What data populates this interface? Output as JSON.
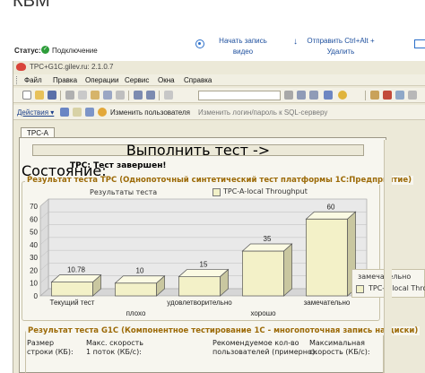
{
  "page_heading": "КВМ",
  "topbar": {
    "status_label": "Статус:",
    "status_value": "Подключение",
    "record_label_1": "Начать запись",
    "record_label_2": "видео",
    "send_label_1": "Отправить Ctrl+Alt +",
    "send_label_2": "Удалить"
  },
  "window": {
    "title": "TPC+G1C.gilev.ru: 2.1.0.7"
  },
  "menu": [
    "Файл",
    "Правка",
    "Операции",
    "Сервис",
    "Окна",
    "Справка"
  ],
  "actionbar": {
    "actions_label": "Действия ▾",
    "change_user_label": "Изменить пользователя",
    "change_login_label": "Изменить логин/пароль к SQL-серверу"
  },
  "tab_label": "TPC-A",
  "run_test_label": "Выполнить тест ->",
  "state": {
    "label": "Состояние:",
    "value": "TPC: Тест завершен!"
  },
  "group1_title": "Результат теста TPC (Однопоточный синтетический тест платформы 1С:Предприятие)",
  "legend": {
    "left": "Результаты теста",
    "right": "TPC-A-local Throughput",
    "side_line1": "замечательно",
    "side_line2": "TPC-A-local Throughput"
  },
  "colors": {
    "bar_front": "#f3f1c8",
    "bar_side": "#c9c7a0",
    "bar_top": "#fbfae3",
    "plot_back": "#e9e9e9",
    "group_title": "#9c6a07"
  },
  "chart_data": {
    "type": "bar",
    "categories": [
      "Текущий тест",
      "плохо",
      "удовлетворительно",
      "хорошо",
      "замечательно"
    ],
    "series": [
      {
        "name": "TPC-A-local Throughput",
        "values": [
          10.78,
          10,
          15,
          35,
          60
        ]
      }
    ],
    "value_labels": [
      "10.78",
      "10",
      "15",
      "35",
      "60"
    ],
    "yticks": [
      "0",
      "10",
      "20",
      "30",
      "40",
      "50",
      "60",
      "70"
    ],
    "ylim": [
      0,
      70
    ]
  },
  "group2_title": "Результат теста G1C (Компонентное тестирование 1С - многопоточная запись на диски)",
  "group2": {
    "col1": [
      "Размер",
      "строки (КБ):"
    ],
    "col2": [
      "Макс. скорость",
      "1 поток (КБ/с):"
    ],
    "col3": [
      "Рекомендуемое кол-во",
      "пользователей (примерно):"
    ],
    "col4": [
      "Максимальная",
      "скорость (КБ/с):"
    ]
  }
}
